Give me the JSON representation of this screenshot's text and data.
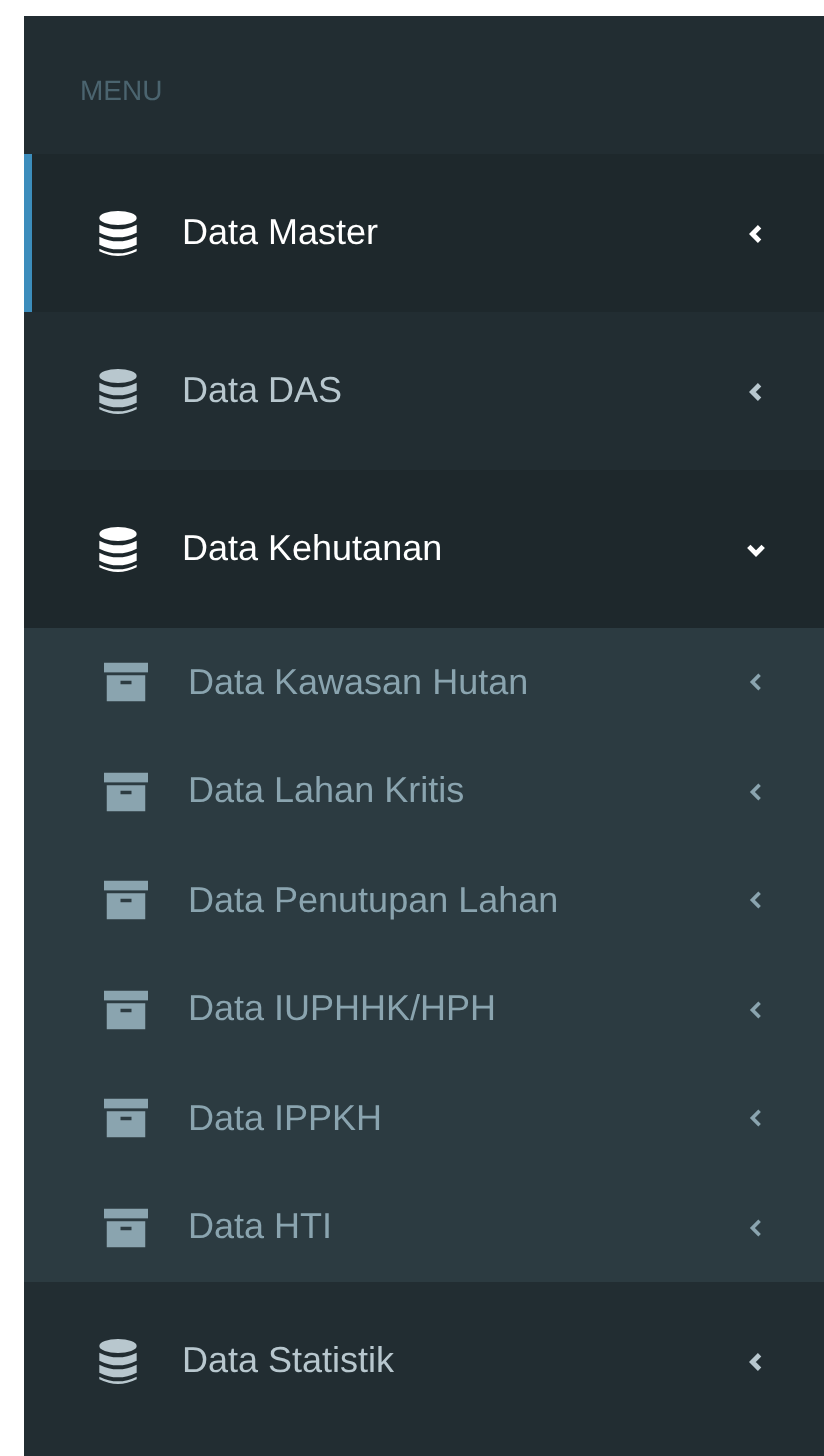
{
  "sidebar": {
    "header": "MENU",
    "items": [
      {
        "label": "Data Master",
        "selected": true,
        "expanded": false
      },
      {
        "label": "Data DAS",
        "selected": false,
        "expanded": false
      },
      {
        "label": "Data Kehutanan",
        "selected": false,
        "expanded": true,
        "children": [
          {
            "label": "Data Kawasan Hutan",
            "expanded": false
          },
          {
            "label": "Data Lahan Kritis",
            "expanded": false
          },
          {
            "label": "Data Penutupan Lahan",
            "expanded": false
          },
          {
            "label": "Data IUPHHK/HPH",
            "expanded": false
          },
          {
            "label": "Data IPPKH",
            "expanded": false
          },
          {
            "label": "Data HTI",
            "expanded": false
          }
        ]
      },
      {
        "label": "Data Statistik",
        "selected": false,
        "expanded": false
      }
    ]
  }
}
